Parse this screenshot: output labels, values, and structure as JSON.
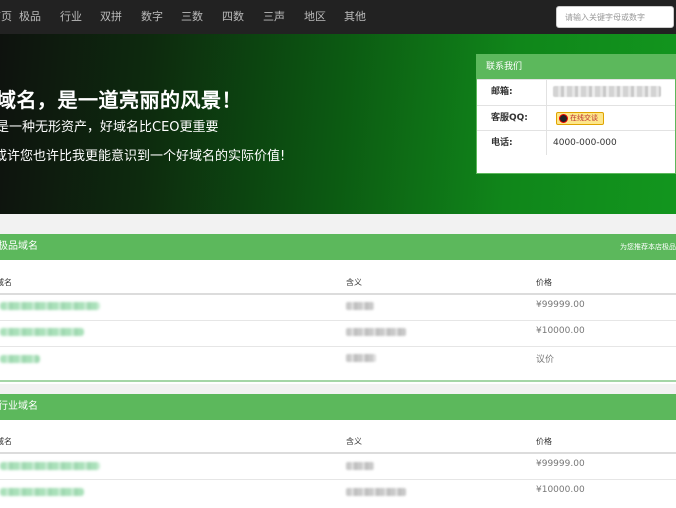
{
  "nav": {
    "items": [
      {
        "label": "首页"
      },
      {
        "label": "极品"
      },
      {
        "label": "行业"
      },
      {
        "label": "双拼"
      },
      {
        "label": "数字"
      },
      {
        "label": "三数"
      },
      {
        "label": "四数"
      },
      {
        "label": "三声"
      },
      {
        "label": "地区"
      },
      {
        "label": "其他"
      }
    ],
    "search_placeholder": "请输入关键字母或数字"
  },
  "hero": {
    "title": "域名，是一道亮丽的风景！",
    "subtitle": "是一种无形资产，好域名比CEO更重要",
    "tagline": "或许您也许比我更能意识到一个好域名的实际价值!"
  },
  "contact": {
    "title": "联系我们",
    "rows": [
      {
        "label": "邮箱:",
        "value": ""
      },
      {
        "label": "客服QQ:",
        "value": "",
        "qq_button": "在线交谈"
      },
      {
        "label": "电话:",
        "value": "4000-000-000"
      }
    ]
  },
  "sections": [
    {
      "title": "极品域名",
      "link": "为您推荐本店极品",
      "columns": [
        "域名",
        "含义",
        "价格"
      ],
      "rows": [
        {
          "price": "¥99999.00"
        },
        {
          "price": "¥10000.00"
        },
        {
          "price": "议价"
        }
      ]
    },
    {
      "title": "行业域名",
      "link": "",
      "columns": [
        "域名",
        "含义",
        "价格"
      ],
      "rows": [
        {
          "price": "¥99999.00"
        },
        {
          "price": "¥10000.00"
        }
      ]
    }
  ],
  "colors": {
    "nav_bg": "#222222",
    "accent_green": "#5cb85c",
    "hero_dark": "#0e120e",
    "hero_green": "#12961e"
  }
}
